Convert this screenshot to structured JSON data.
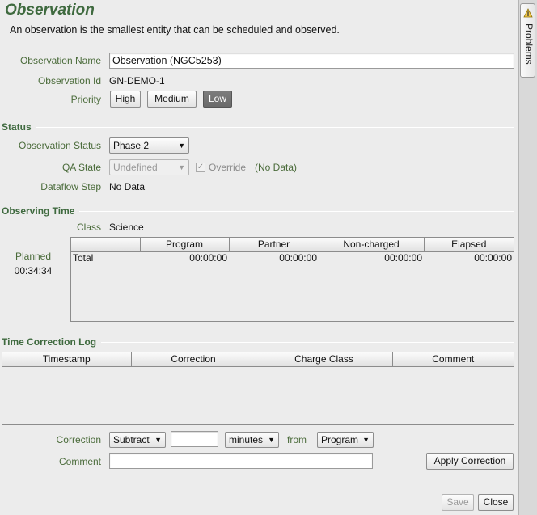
{
  "header": {
    "title": "Observation",
    "subtitle": "An observation is the smallest entity that can be scheduled and observed."
  },
  "fields": {
    "name_label": "Observation Name",
    "name_value": "Observation (NGC5253)",
    "id_label": "Observation Id",
    "id_value": "GN-DEMO-1",
    "priority_label": "Priority",
    "priority_options": [
      "High",
      "Medium",
      "Low"
    ],
    "priority_selected": "Low"
  },
  "status": {
    "section_title": "Status",
    "obs_status_label": "Observation Status",
    "obs_status_value": "Phase 2",
    "qa_label": "QA State",
    "qa_value": "Undefined",
    "override_label": "Override",
    "override_checked": true,
    "no_data_note": "(No Data)",
    "dataflow_label": "Dataflow Step",
    "dataflow_value": "No Data"
  },
  "observing_time": {
    "section_title": "Observing Time",
    "class_label": "Class",
    "class_value": "Science",
    "planned_label": "Planned",
    "planned_value": "00:34:34",
    "columns": [
      "",
      "Program",
      "Partner",
      "Non-charged",
      "Elapsed"
    ],
    "rows": [
      [
        "Total",
        "00:00:00",
        "00:00:00",
        "00:00:00",
        "00:00:00"
      ]
    ]
  },
  "time_correction": {
    "section_title": "Time Correction Log",
    "columns": [
      "Timestamp",
      "Correction",
      "Charge Class",
      "Comment"
    ],
    "correction_label": "Correction",
    "operation_value": "Subtract",
    "amount_value": "",
    "unit_value": "minutes",
    "from_label": "from",
    "from_value": "Program",
    "comment_label": "Comment",
    "comment_value": "",
    "apply_label": "Apply Correction"
  },
  "footer": {
    "save_label": "Save",
    "close_label": "Close"
  },
  "sidebar": {
    "problems_label": "Problems",
    "warning_icon": "warning-icon"
  }
}
